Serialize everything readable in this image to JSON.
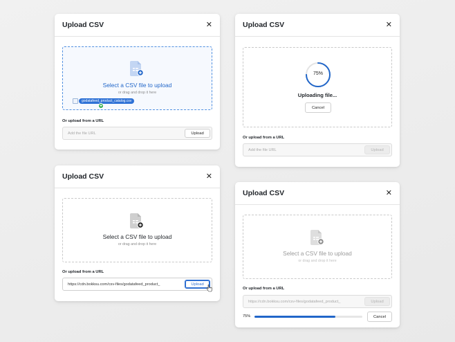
{
  "dialog_title": "Upload CSV",
  "close_glyph": "✕",
  "url_label": "Or upload from a URL",
  "upload_label": "Upload",
  "cancel_label": "Cancel",
  "colors": {
    "accent": "#2166c9",
    "success": "#2aa84a",
    "border_dashed": "#c9c9c9"
  },
  "icons": [
    "csv-file-icon",
    "plus-badge-icon",
    "close-icon",
    "pointer-cursor-icon"
  ],
  "card1": {
    "dropzone_title": "Select a CSV file to upload",
    "dropzone_sub": "or drag and drop it here",
    "dragged_file": "godatafeed_product_catalog.csv",
    "url_placeholder": "Add the file URL"
  },
  "card2": {
    "progress_percent_text": "75%",
    "progress": 0.75,
    "status": "Uploading file...",
    "url_placeholder": "Add the file URL"
  },
  "card3": {
    "dropzone_title": "Select a CSV file to upload",
    "dropzone_sub": "or drag and drop it here",
    "url_value": "https://cdn.bokksu.com/csv-files/godatafeed_product_"
  },
  "card4": {
    "dropzone_title": "Select a CSV file to upload",
    "dropzone_sub": "or drag and drop it here",
    "url_value": "https://cdn.bokksu.com/csv-files/godatafeed_product_",
    "progress_percent_text": "75%",
    "progress": 0.75
  }
}
